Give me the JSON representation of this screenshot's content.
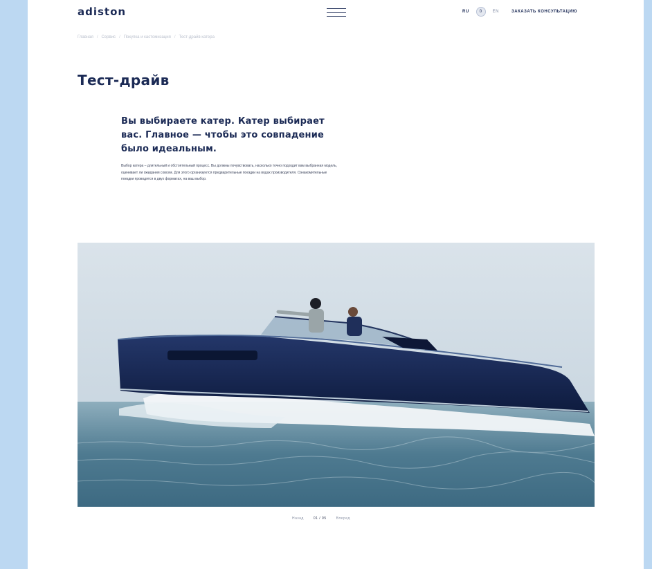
{
  "header": {
    "logo": "adiston",
    "lang_ru": "RU",
    "cart_count": "0",
    "lang_en": "EN",
    "consult_label": "Заказать консультацию"
  },
  "breadcrumb": [
    "Главная",
    "Сервис",
    "Покупка и кастомизация",
    "Тест-драйв катера"
  ],
  "page": {
    "title": "Тест-драйв",
    "lead": "Вы выбираете катер. Катер выбирает вас. Главное — чтобы это совпадение было идеальным.",
    "body": "Выбор катера – длительный и обстоятельный процесс. Вы должны почувствовать, насколько точно подходит вам выбранная модель, оценивает ли ожидания совсем. Для этого организуются предварительные поездки на водах производителя. Ознакомительные поездки проводятся в двух форматах, на ваш выбор."
  },
  "slider": {
    "prev_label": "Назад",
    "counter": "01 / 05",
    "next_label": "Вперед"
  },
  "colors": {
    "brand": "#1b2a55",
    "background": "#bcd8f2"
  }
}
